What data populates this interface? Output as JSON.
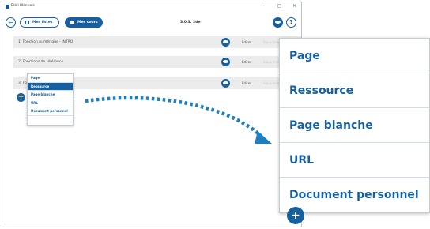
{
  "window": {
    "title": "Bibli Manuels",
    "version": "3.0.3. 2de"
  },
  "toolbar": {
    "back_icon": "arrow-left-icon",
    "tabs": [
      {
        "label": "Mes listes",
        "icon": "calendar-icon",
        "active": false
      },
      {
        "label": "Mes cours",
        "icon": "book-icon",
        "active": true
      }
    ],
    "eye_icon": "eye-icon",
    "help_label": "?"
  },
  "window_controls": {
    "minimize": "–",
    "maximize": "□",
    "close": "×"
  },
  "rows": [
    {
      "label": "1. Fonction numérique - INTRO",
      "edit": "Editer",
      "delete": "Supprimer"
    },
    {
      "label": "2. Fonctions de référence",
      "edit": "Editer",
      "delete": "Supprimer"
    },
    {
      "label": "3. Fo",
      "edit": "Editer",
      "delete": "Supprimer"
    }
  ],
  "add_menu": {
    "items": [
      "Page",
      "Ressource",
      "Page blanche",
      "URL",
      "Document personnel"
    ],
    "highlighted": "Ressource"
  },
  "add_button_label": "+",
  "colors": {
    "accent": "#16609f",
    "row_bg": "#ececec",
    "arrow": "#1c7fc0"
  }
}
